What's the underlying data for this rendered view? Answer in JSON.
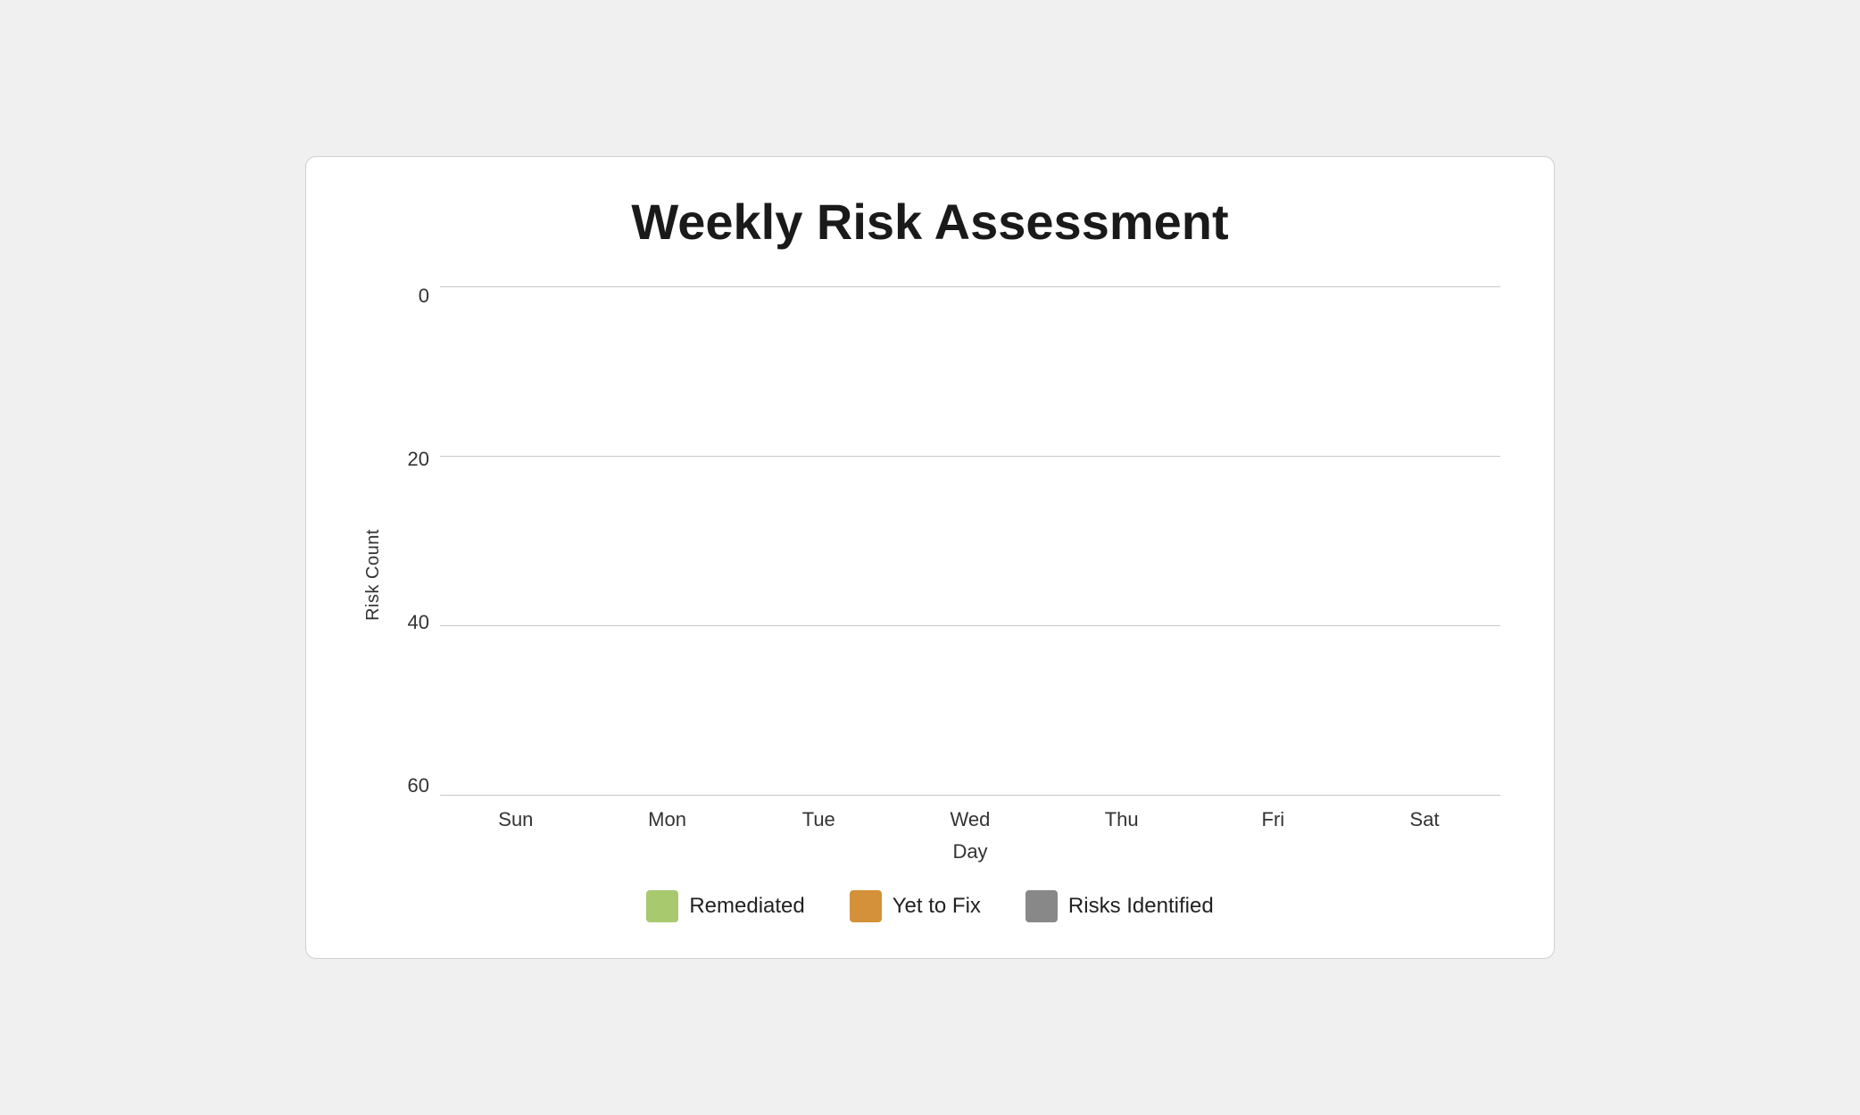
{
  "chart": {
    "title": "Weekly Risk Assessment",
    "y_axis_label": "Risk Count",
    "x_axis_label": "Day",
    "y_ticks": [
      "0",
      "20",
      "40",
      "60"
    ],
    "x_ticks": [
      "Sun",
      "Mon",
      "Tue",
      "Wed",
      "Thu",
      "Fri",
      "Sat"
    ],
    "legend": [
      {
        "label": "Remediated",
        "color": "#a8c96e"
      },
      {
        "label": "Yet to Fix",
        "color": "#d4913a"
      },
      {
        "label": "Risks Identified",
        "color": "#888888"
      }
    ]
  }
}
